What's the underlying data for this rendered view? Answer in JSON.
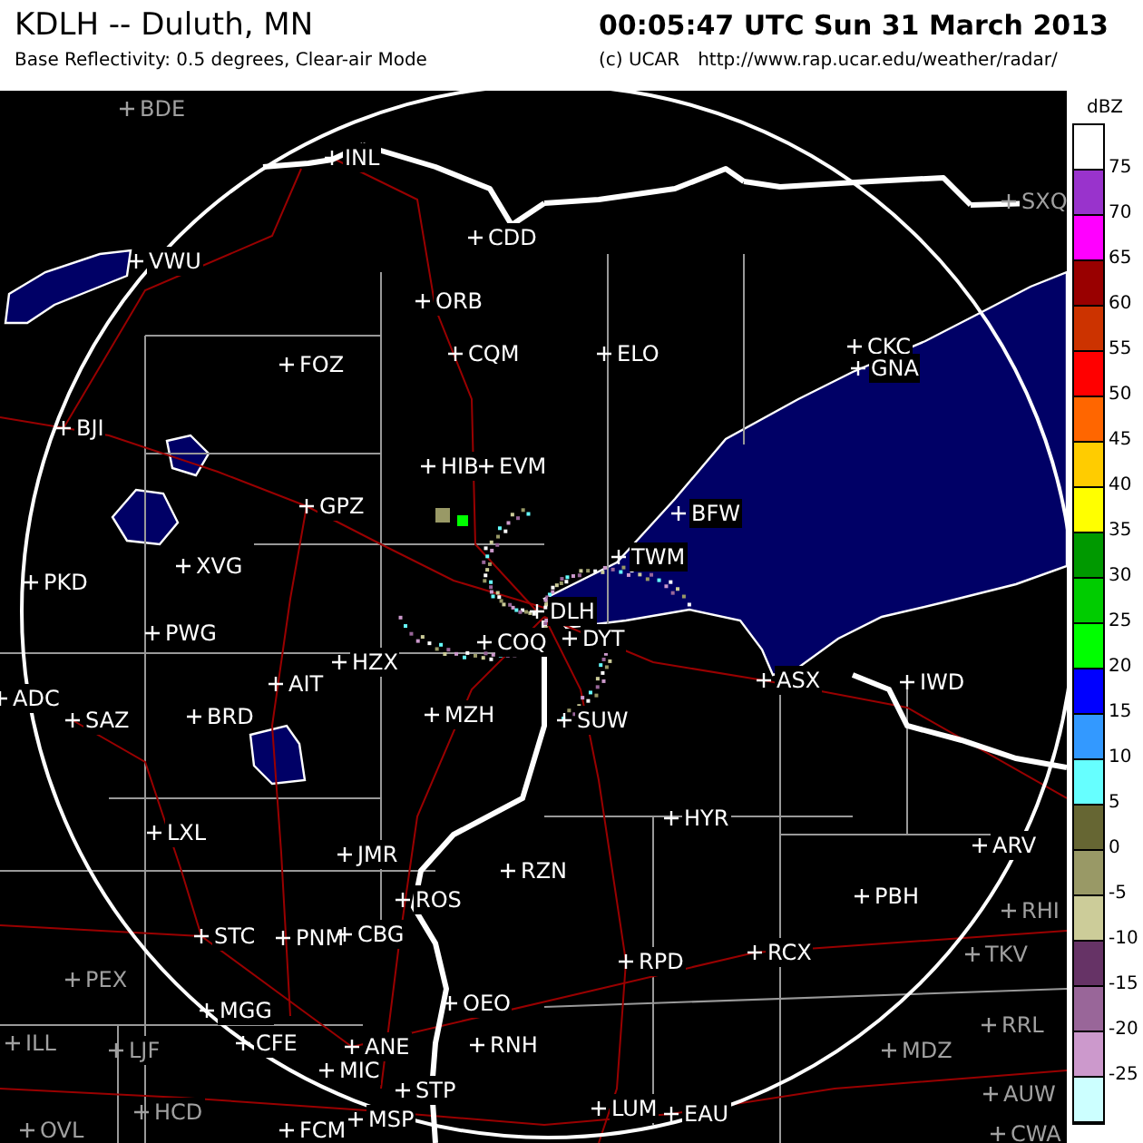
{
  "header": {
    "station": "KDLH -- Duluth, MN",
    "product": "Base Reflectivity: 0.5 degrees, Clear-air Mode",
    "timestamp": "00:05:47 UTC Sun 31 March 2013",
    "credit": "(c) UCAR",
    "url": "http://www.rap.ucar.edu/weather/radar/"
  },
  "stations": [
    {
      "label": "BDE",
      "in_range": false
    },
    {
      "label": "INL",
      "in_range": true
    },
    {
      "label": "VWU",
      "in_range": true
    },
    {
      "label": "CDD",
      "in_range": true
    },
    {
      "label": "ORB",
      "in_range": true
    },
    {
      "label": "CQM",
      "in_range": true
    },
    {
      "label": "FOZ",
      "in_range": true
    },
    {
      "label": "ELO",
      "in_range": true
    },
    {
      "label": "CKC",
      "in_range": true
    },
    {
      "label": "GNA",
      "in_range": true
    },
    {
      "label": "SXQ",
      "in_range": false
    },
    {
      "label": "BJI",
      "in_range": true
    },
    {
      "label": "HIB",
      "in_range": true
    },
    {
      "label": "EVM",
      "in_range": true
    },
    {
      "label": "GPZ",
      "in_range": true
    },
    {
      "label": "BFW",
      "in_range": true
    },
    {
      "label": "TWM",
      "in_range": true
    },
    {
      "label": "DLH",
      "in_range": true
    },
    {
      "label": "XVG",
      "in_range": true
    },
    {
      "label": "PKD",
      "in_range": true
    },
    {
      "label": "PWG",
      "in_range": true
    },
    {
      "label": "HZX",
      "in_range": true
    },
    {
      "label": "COQ",
      "in_range": true
    },
    {
      "label": "DYT",
      "in_range": true
    },
    {
      "label": "AIT",
      "in_range": true
    },
    {
      "label": "ADC",
      "in_range": true
    },
    {
      "label": "SAZ",
      "in_range": true
    },
    {
      "label": "BRD",
      "in_range": true
    },
    {
      "label": "ASX",
      "in_range": true
    },
    {
      "label": "IWD",
      "in_range": true
    },
    {
      "label": "MZH",
      "in_range": true
    },
    {
      "label": "SUW",
      "in_range": true
    },
    {
      "label": "LXL",
      "in_range": true
    },
    {
      "label": "HYR",
      "in_range": true
    },
    {
      "label": "JMR",
      "in_range": true
    },
    {
      "label": "ARV",
      "in_range": true
    },
    {
      "label": "RZN",
      "in_range": true
    },
    {
      "label": "ROS",
      "in_range": true
    },
    {
      "label": "PBH",
      "in_range": true
    },
    {
      "label": "RHI",
      "in_range": false
    },
    {
      "label": "STC",
      "in_range": true
    },
    {
      "label": "PNM",
      "in_range": true
    },
    {
      "label": "CBG",
      "in_range": true
    },
    {
      "label": "TKV",
      "in_range": false
    },
    {
      "label": "RPD",
      "in_range": true
    },
    {
      "label": "RCX",
      "in_range": true
    },
    {
      "label": "PEX",
      "in_range": false
    },
    {
      "label": "MGG",
      "in_range": true
    },
    {
      "label": "CFE",
      "in_range": true
    },
    {
      "label": "OEO",
      "in_range": true
    },
    {
      "label": "RRL",
      "in_range": false
    },
    {
      "label": "ILL",
      "in_range": false
    },
    {
      "label": "LJF",
      "in_range": false
    },
    {
      "label": "ANE",
      "in_range": true
    },
    {
      "label": "RNH",
      "in_range": true
    },
    {
      "label": "MDZ",
      "in_range": false
    },
    {
      "label": "MIC",
      "in_range": true
    },
    {
      "label": "AUW",
      "in_range": false
    },
    {
      "label": "STP",
      "in_range": true
    },
    {
      "label": "HCD",
      "in_range": false
    },
    {
      "label": "MSP",
      "in_range": true
    },
    {
      "label": "LUM",
      "in_range": true
    },
    {
      "label": "EAU",
      "in_range": true
    },
    {
      "label": "OVL",
      "in_range": false
    },
    {
      "label": "FCM",
      "in_range": true
    },
    {
      "label": "CWA",
      "in_range": false
    }
  ],
  "legend": {
    "unit": "dBZ",
    "bins": [
      {
        "color": "#ffffff"
      },
      {
        "color": "#9933cc"
      },
      {
        "color": "#ff00ff"
      },
      {
        "color": "#990000"
      },
      {
        "color": "#cc3300"
      },
      {
        "color": "#ff0000"
      },
      {
        "color": "#ff6600"
      },
      {
        "color": "#ffcc00"
      },
      {
        "color": "#ffff00"
      },
      {
        "color": "#009900"
      },
      {
        "color": "#00cc00"
      },
      {
        "color": "#00ff00"
      },
      {
        "color": "#0000ff"
      },
      {
        "color": "#3399ff"
      },
      {
        "color": "#66ffff"
      },
      {
        "color": "#666633"
      },
      {
        "color": "#999966"
      },
      {
        "color": "#cccc99"
      },
      {
        "color": "#663366"
      },
      {
        "color": "#996699"
      },
      {
        "color": "#cc99cc"
      },
      {
        "color": "#ccffff"
      }
    ],
    "labels": [
      "75",
      "70",
      "65",
      "60",
      "55",
      "50",
      "45",
      "40",
      "35",
      "30",
      "25",
      "20",
      "15",
      "10",
      "5",
      "0",
      "-5",
      "-10",
      "-15",
      "-20",
      "-25"
    ]
  }
}
